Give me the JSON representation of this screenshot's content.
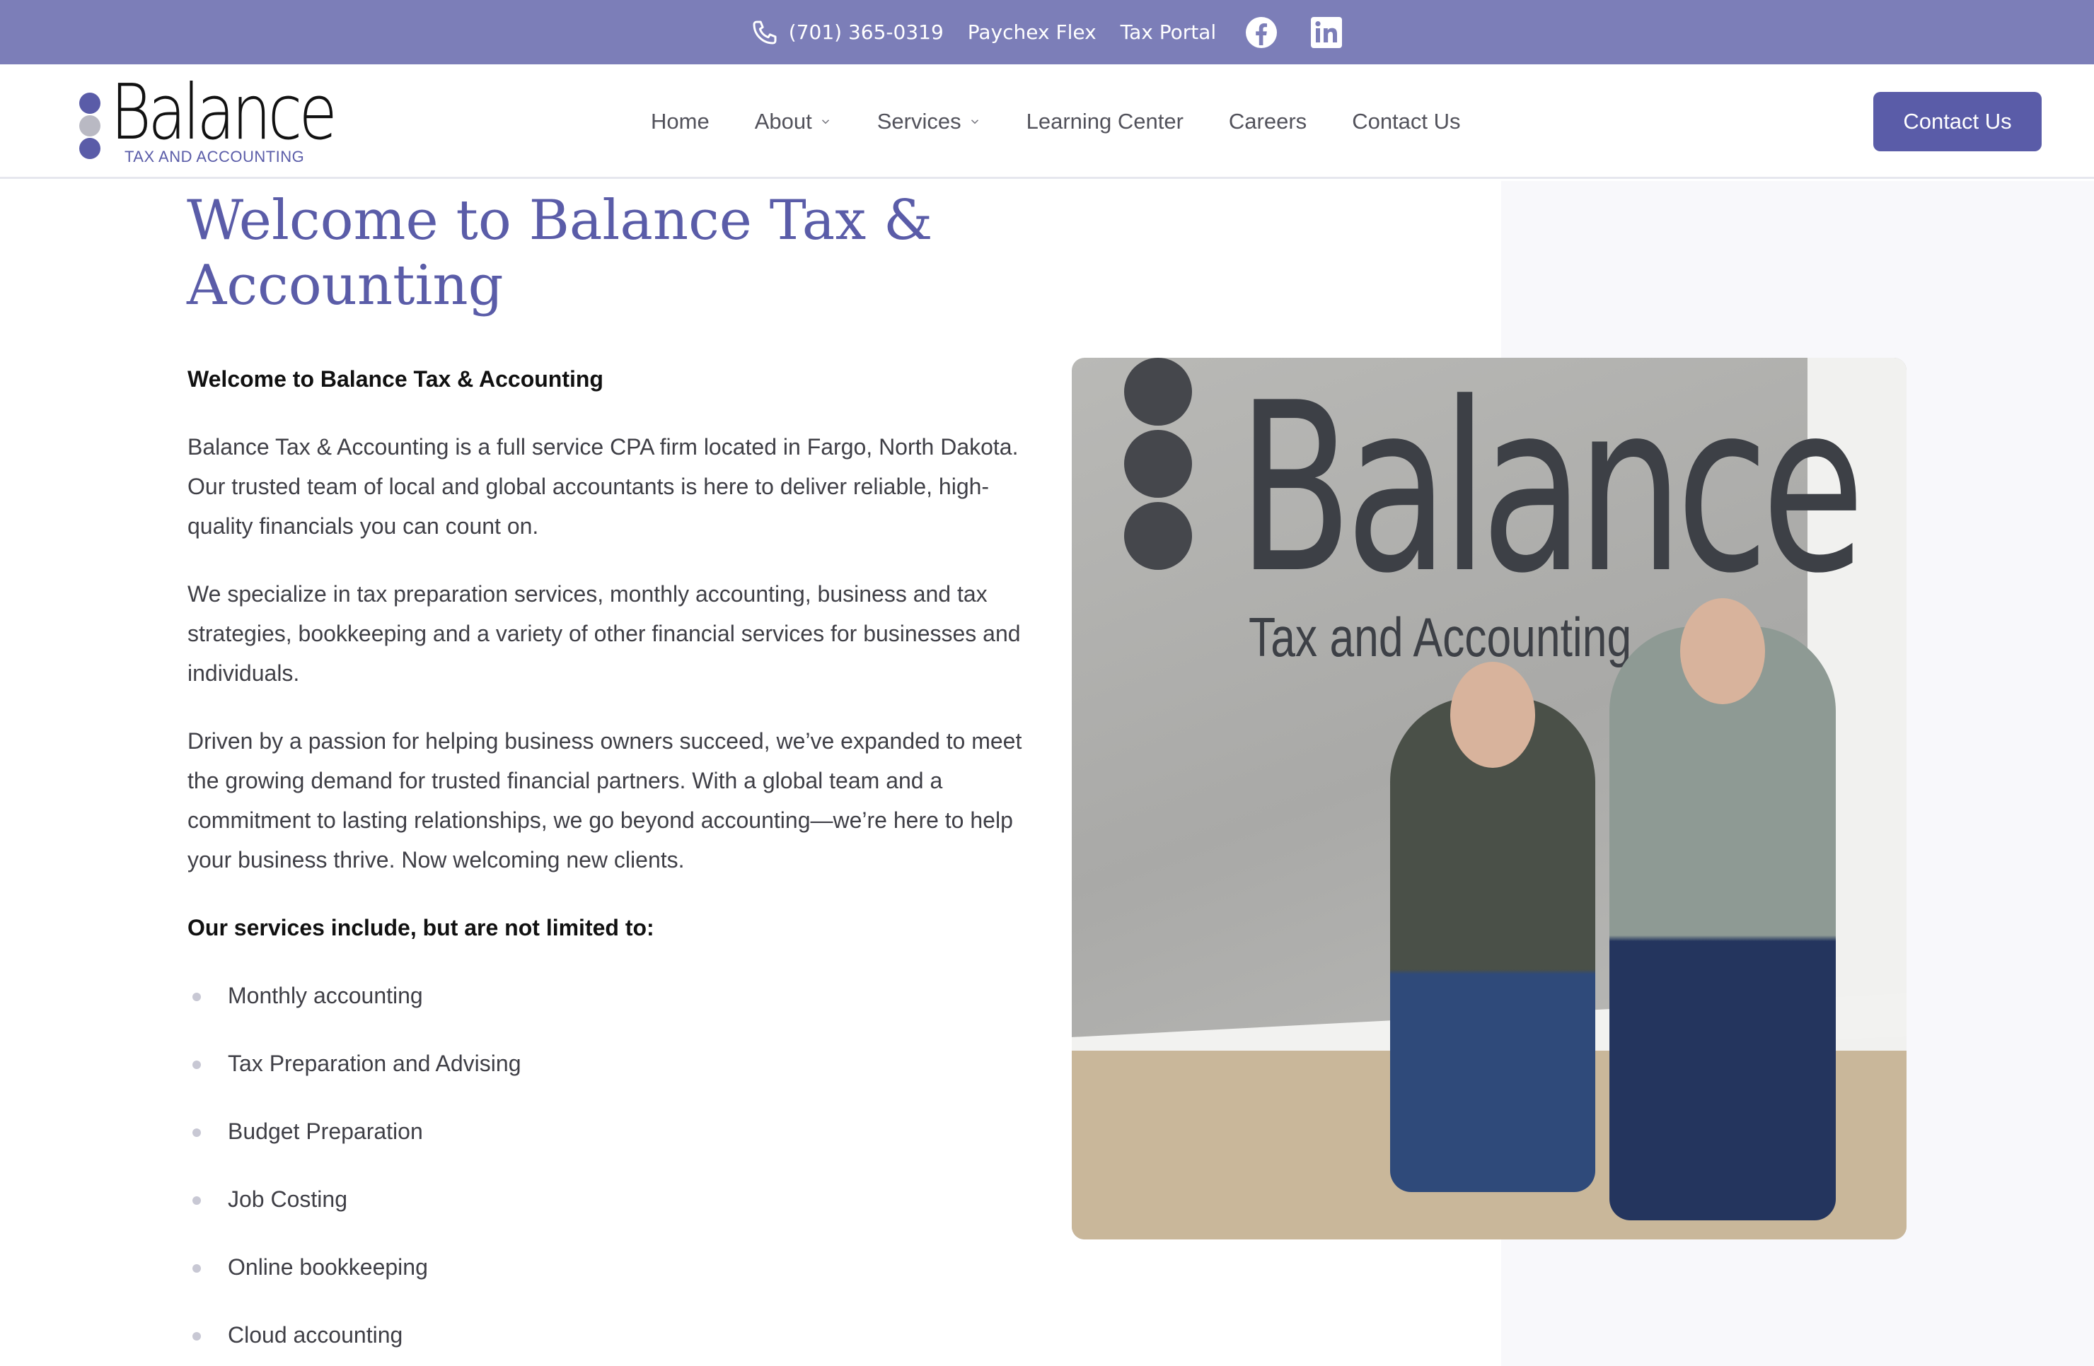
{
  "topbar": {
    "phone": "(701) 365-0319",
    "links": [
      "Paychex Flex",
      "Tax Portal"
    ],
    "social": [
      "facebook-icon",
      "linkedin-icon"
    ]
  },
  "header": {
    "logo_word": "Balance",
    "logo_tagline": "TAX AND ACCOUNTING",
    "nav": [
      {
        "label": "Home",
        "dropdown": false
      },
      {
        "label": "About",
        "dropdown": true
      },
      {
        "label": "Services",
        "dropdown": true
      },
      {
        "label": "Learning Center",
        "dropdown": false
      },
      {
        "label": "Careers",
        "dropdown": false
      },
      {
        "label": "Contact Us",
        "dropdown": false
      }
    ],
    "cta_label": "Contact Us"
  },
  "main": {
    "title": "Welcome to Balance Tax & Accounting",
    "lead": "Welcome to Balance Tax & Accounting",
    "paragraphs": [
      "Balance Tax & Accounting is a full service CPA firm located in Fargo, North Dakota. Our trusted team of local and global accountants is here to deliver reliable, high-quality financials you can count on.",
      "We specialize in tax preparation services, monthly accounting, business and tax strategies, bookkeeping and a variety of other financial services for businesses and individuals.",
      "Driven by a passion for helping business owners succeed, we’ve expanded to meet the growing demand for trusted financial partners. With a global team and a commitment to lasting relationships, we go beyond accounting—we’re here to help your business thrive. Now welcoming new clients."
    ],
    "services_heading": "Our services include, but are not limited to:",
    "services": [
      "Monthly accounting",
      "Tax Preparation and Advising",
      "Budget Preparation",
      "Job Costing",
      "Online bookkeeping",
      "Cloud accounting"
    ]
  },
  "photo": {
    "sign_word": "Balance",
    "sign_sub": "Tax and Accounting"
  },
  "colors": {
    "topbar": "#7c7eb8",
    "brand": "#5a5ca8",
    "panel": "#f8f8fb"
  }
}
